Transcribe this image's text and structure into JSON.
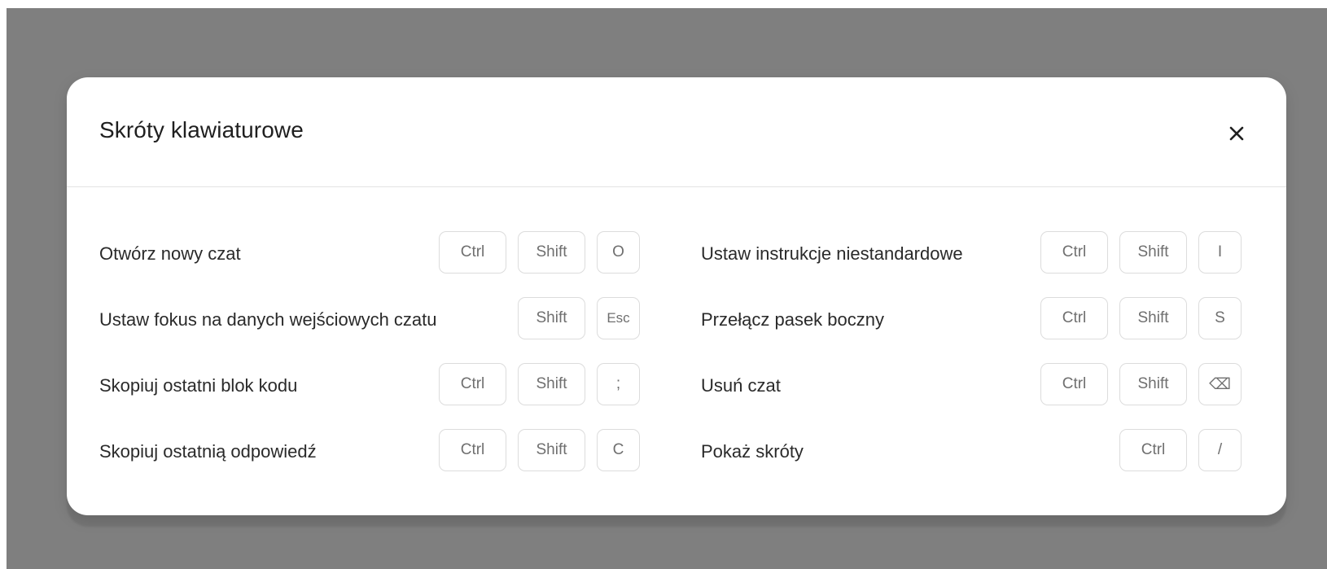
{
  "modal": {
    "title": "Skróty klawiaturowe",
    "close_icon": "close-icon"
  },
  "columns": [
    {
      "rows": [
        {
          "label": "Otwórz nowy czat",
          "keys": [
            "Ctrl",
            "Shift",
            "O"
          ]
        },
        {
          "label": "Ustaw fokus na danych wejściowych czatu",
          "keys": [
            "Shift",
            "Esc"
          ]
        },
        {
          "label": "Skopiuj ostatni blok kodu",
          "keys": [
            "Ctrl",
            "Shift",
            ";"
          ]
        },
        {
          "label": "Skopiuj ostatnią odpowiedź",
          "keys": [
            "Ctrl",
            "Shift",
            "C"
          ]
        }
      ]
    },
    {
      "rows": [
        {
          "label": "Ustaw instrukcje niestandardowe",
          "keys": [
            "Ctrl",
            "Shift",
            "I"
          ]
        },
        {
          "label": "Przełącz pasek boczny",
          "keys": [
            "Ctrl",
            "Shift",
            "S"
          ]
        },
        {
          "label": "Usuń czat",
          "keys": [
            "Ctrl",
            "Shift",
            "⌫"
          ]
        },
        {
          "label": "Pokaż skróty",
          "keys": [
            "Ctrl",
            "/"
          ]
        }
      ]
    }
  ],
  "colors": {
    "backdrop": "#7f7f7f",
    "modal_bg": "#ffffff",
    "divider": "#e3e3e3",
    "key_border": "#dcdcdc",
    "key_text": "#6f6f6f",
    "label_text": "#2a2a2a"
  }
}
